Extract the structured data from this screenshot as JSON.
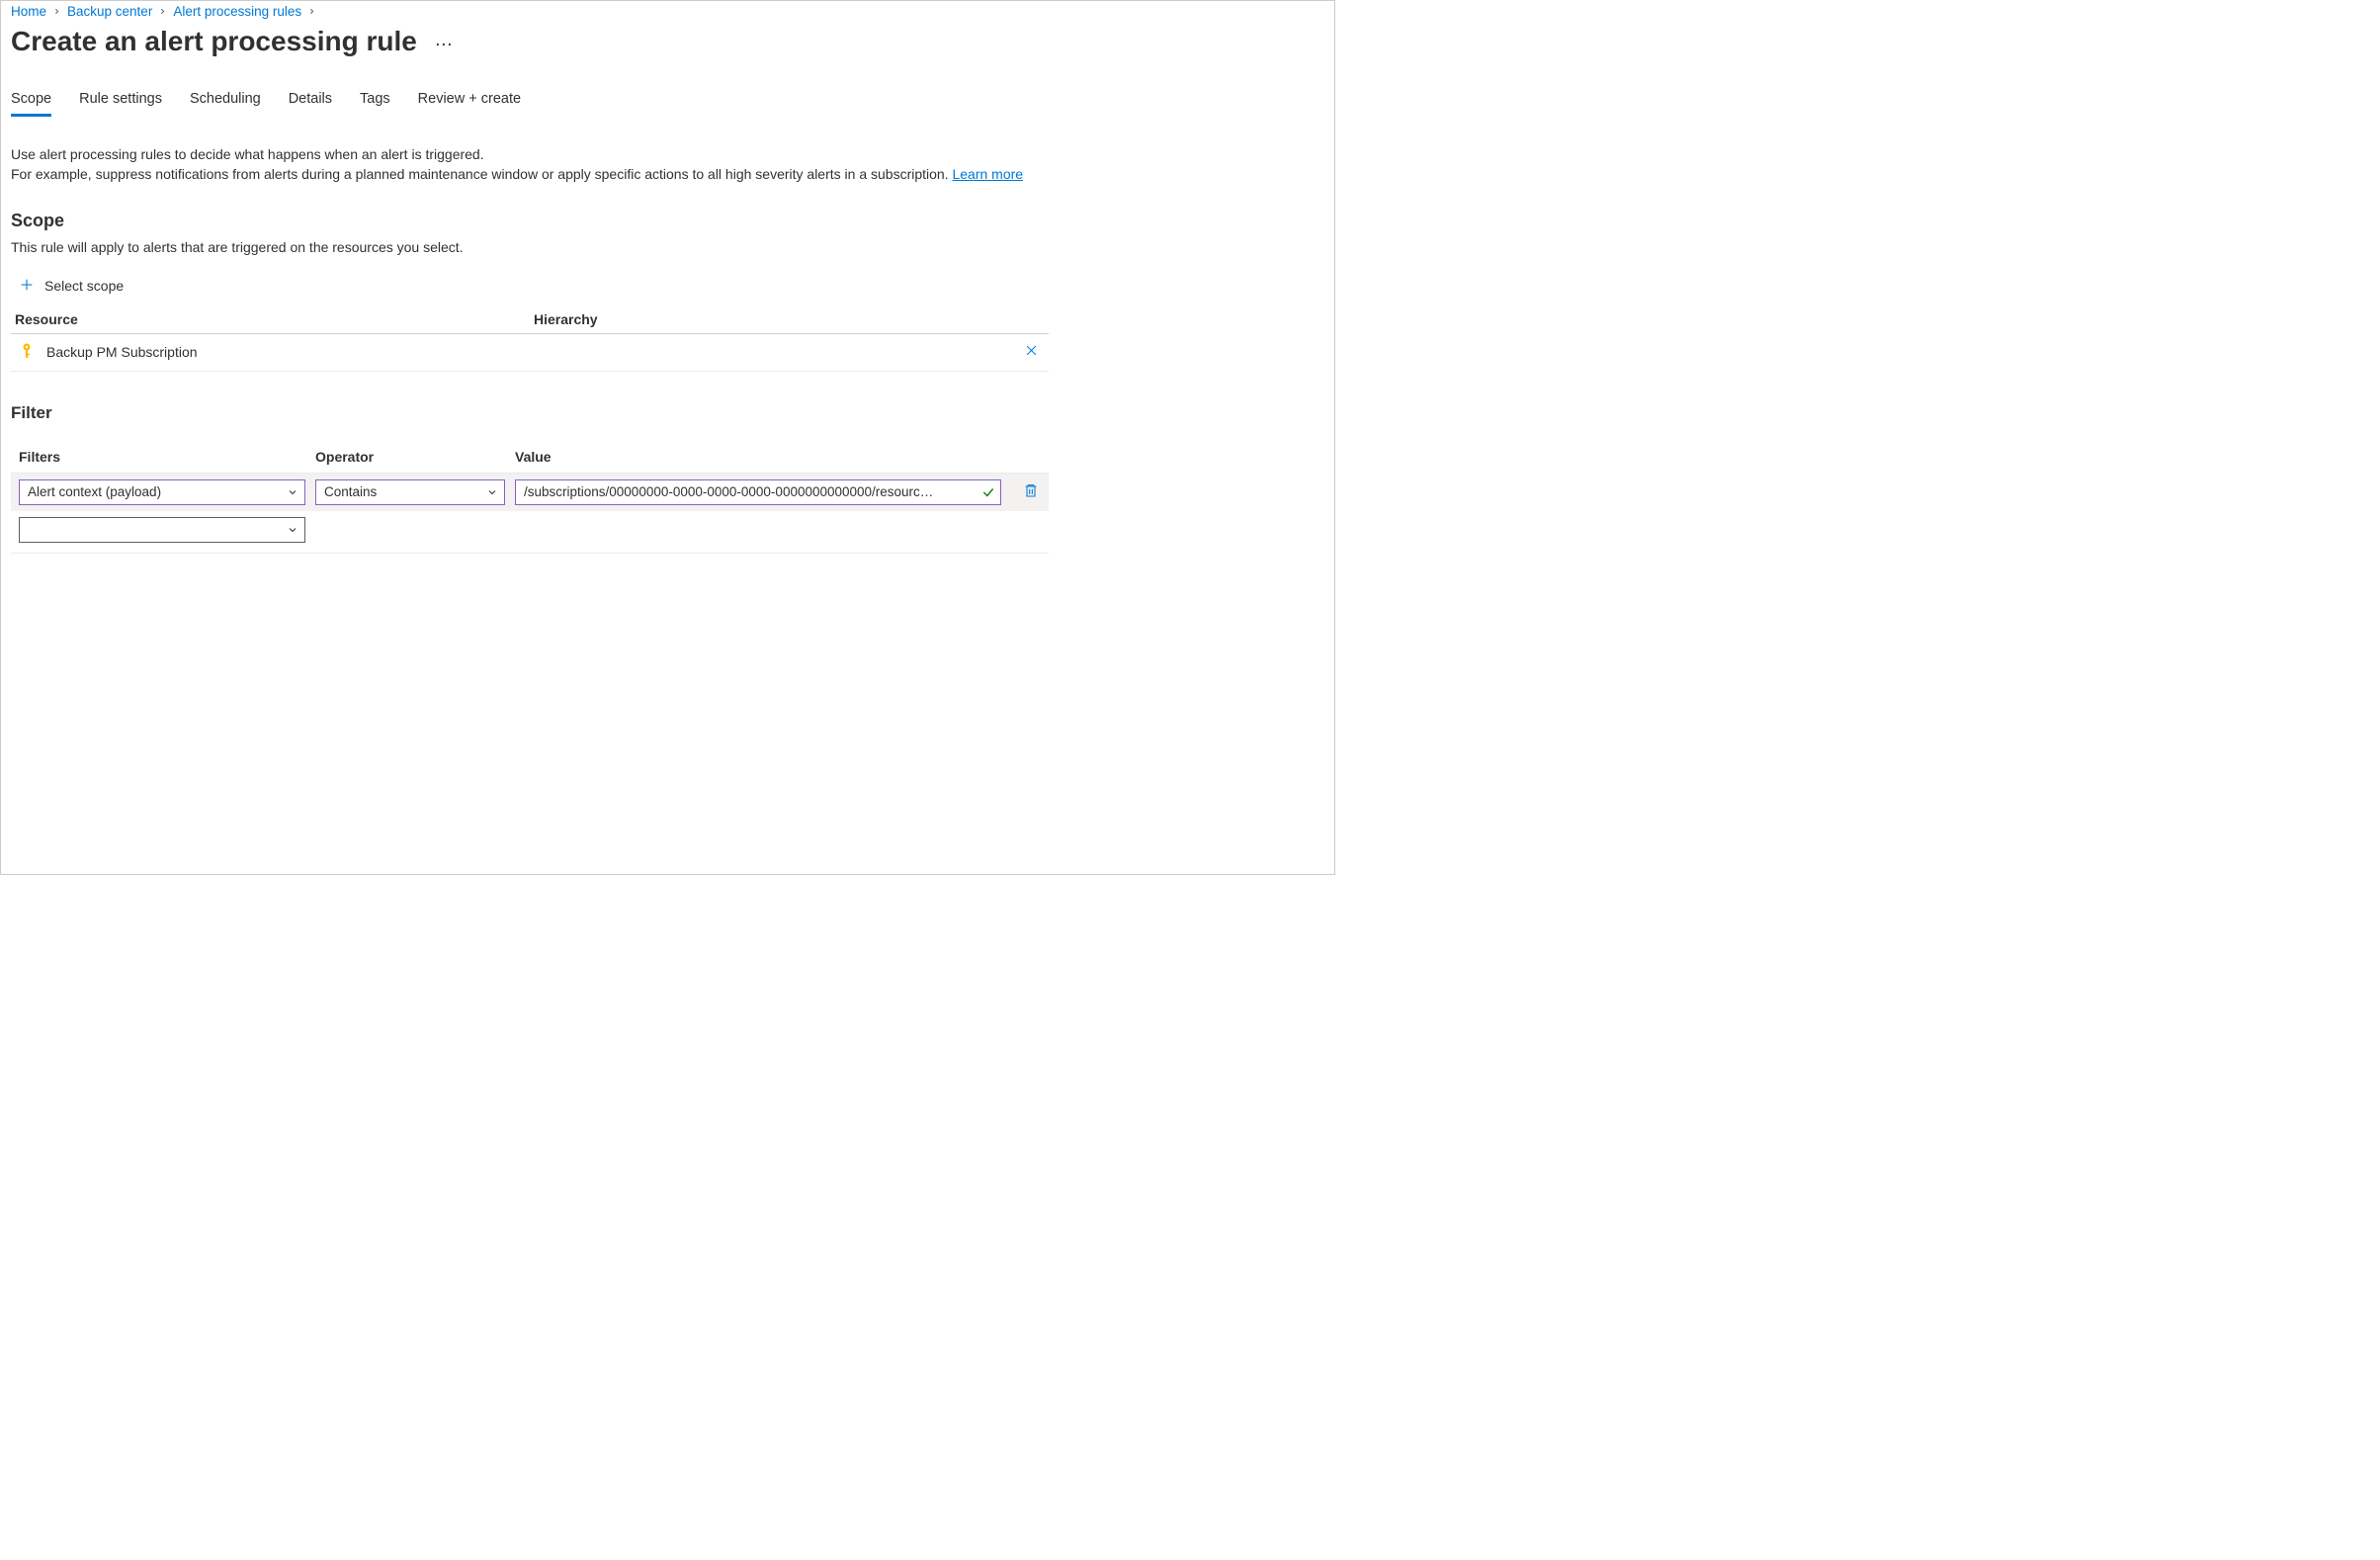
{
  "breadcrumb": {
    "items": [
      "Home",
      "Backup center",
      "Alert processing rules"
    ]
  },
  "page": {
    "title": "Create an alert processing rule"
  },
  "tabs": {
    "items": [
      {
        "label": "Scope",
        "active": true
      },
      {
        "label": "Rule settings",
        "active": false
      },
      {
        "label": "Scheduling",
        "active": false
      },
      {
        "label": "Details",
        "active": false
      },
      {
        "label": "Tags",
        "active": false
      },
      {
        "label": "Review + create",
        "active": false
      }
    ]
  },
  "intro": {
    "line1": "Use alert processing rules to decide what happens when an alert is triggered.",
    "line2": "For example, suppress notifications from alerts during a planned maintenance window or apply specific actions to all high severity alerts in a subscription. ",
    "learn_more": "Learn more"
  },
  "scope": {
    "heading": "Scope",
    "desc": "This rule will apply to alerts that are triggered on the resources you select.",
    "select_scope_label": "Select scope",
    "columns": {
      "resource": "Resource",
      "hierarchy": "Hierarchy"
    },
    "rows": [
      {
        "resource": "Backup PM Subscription",
        "hierarchy": ""
      }
    ]
  },
  "filter": {
    "heading": "Filter",
    "columns": {
      "filters": "Filters",
      "operator": "Operator",
      "value": "Value"
    },
    "rows": [
      {
        "filter_field": "Alert context (payload)",
        "operator": "Contains",
        "value": "/subscriptions/00000000-0000-0000-0000-0000000000000/resourc…"
      }
    ],
    "new_row_filter_field": ""
  }
}
